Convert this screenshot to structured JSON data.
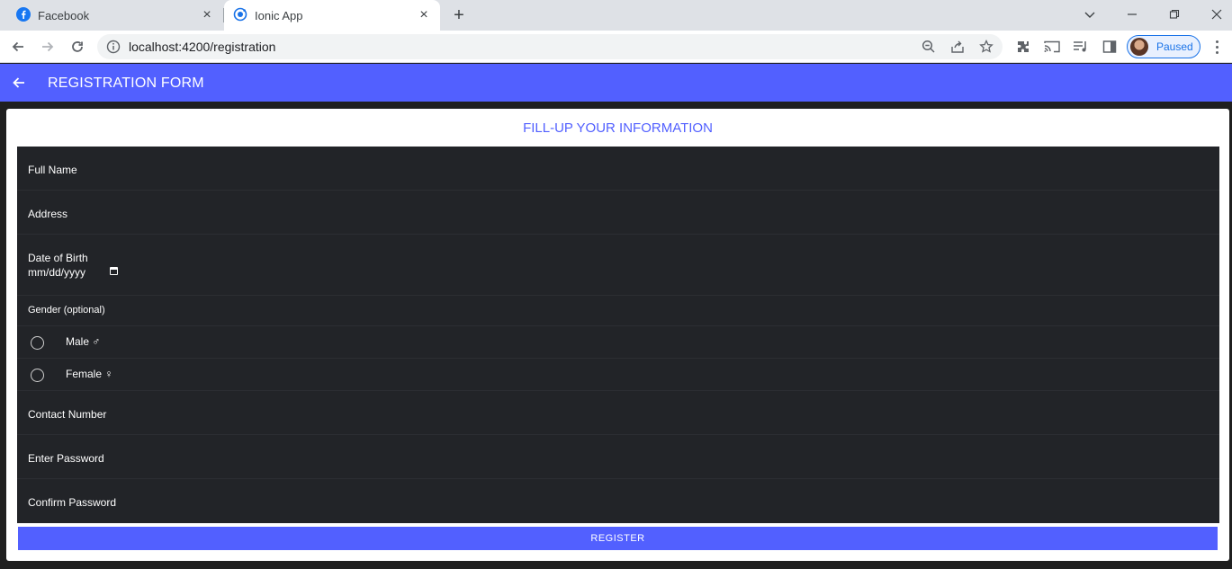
{
  "browser": {
    "tabs": [
      {
        "title": "Facebook",
        "icon": "facebook-icon"
      },
      {
        "title": "Ionic App",
        "icon": "ionic-icon"
      }
    ],
    "url": "localhost:4200/registration",
    "profile_status": "Paused",
    "colors": {
      "tabstrip": "#dee1e6",
      "accent": "#1a73e8"
    }
  },
  "app": {
    "title": "REGISTRATION FORM",
    "header_color": "#5260ff"
  },
  "form": {
    "subtitle": "FILL-UP YOUR INFORMATION",
    "full_name_label": "Full Name",
    "address_label": "Address",
    "dob_label": "Date of Birth",
    "dob_value": "mm/dd/yyyy",
    "gender_label": "Gender (optional)",
    "gender_options": [
      {
        "label": "Male ♂"
      },
      {
        "label": "Female ♀"
      }
    ],
    "contact_label": "Contact Number",
    "password_label": "Enter Password",
    "confirm_password_label": "Confirm Password",
    "register_label": "REGISTER"
  }
}
